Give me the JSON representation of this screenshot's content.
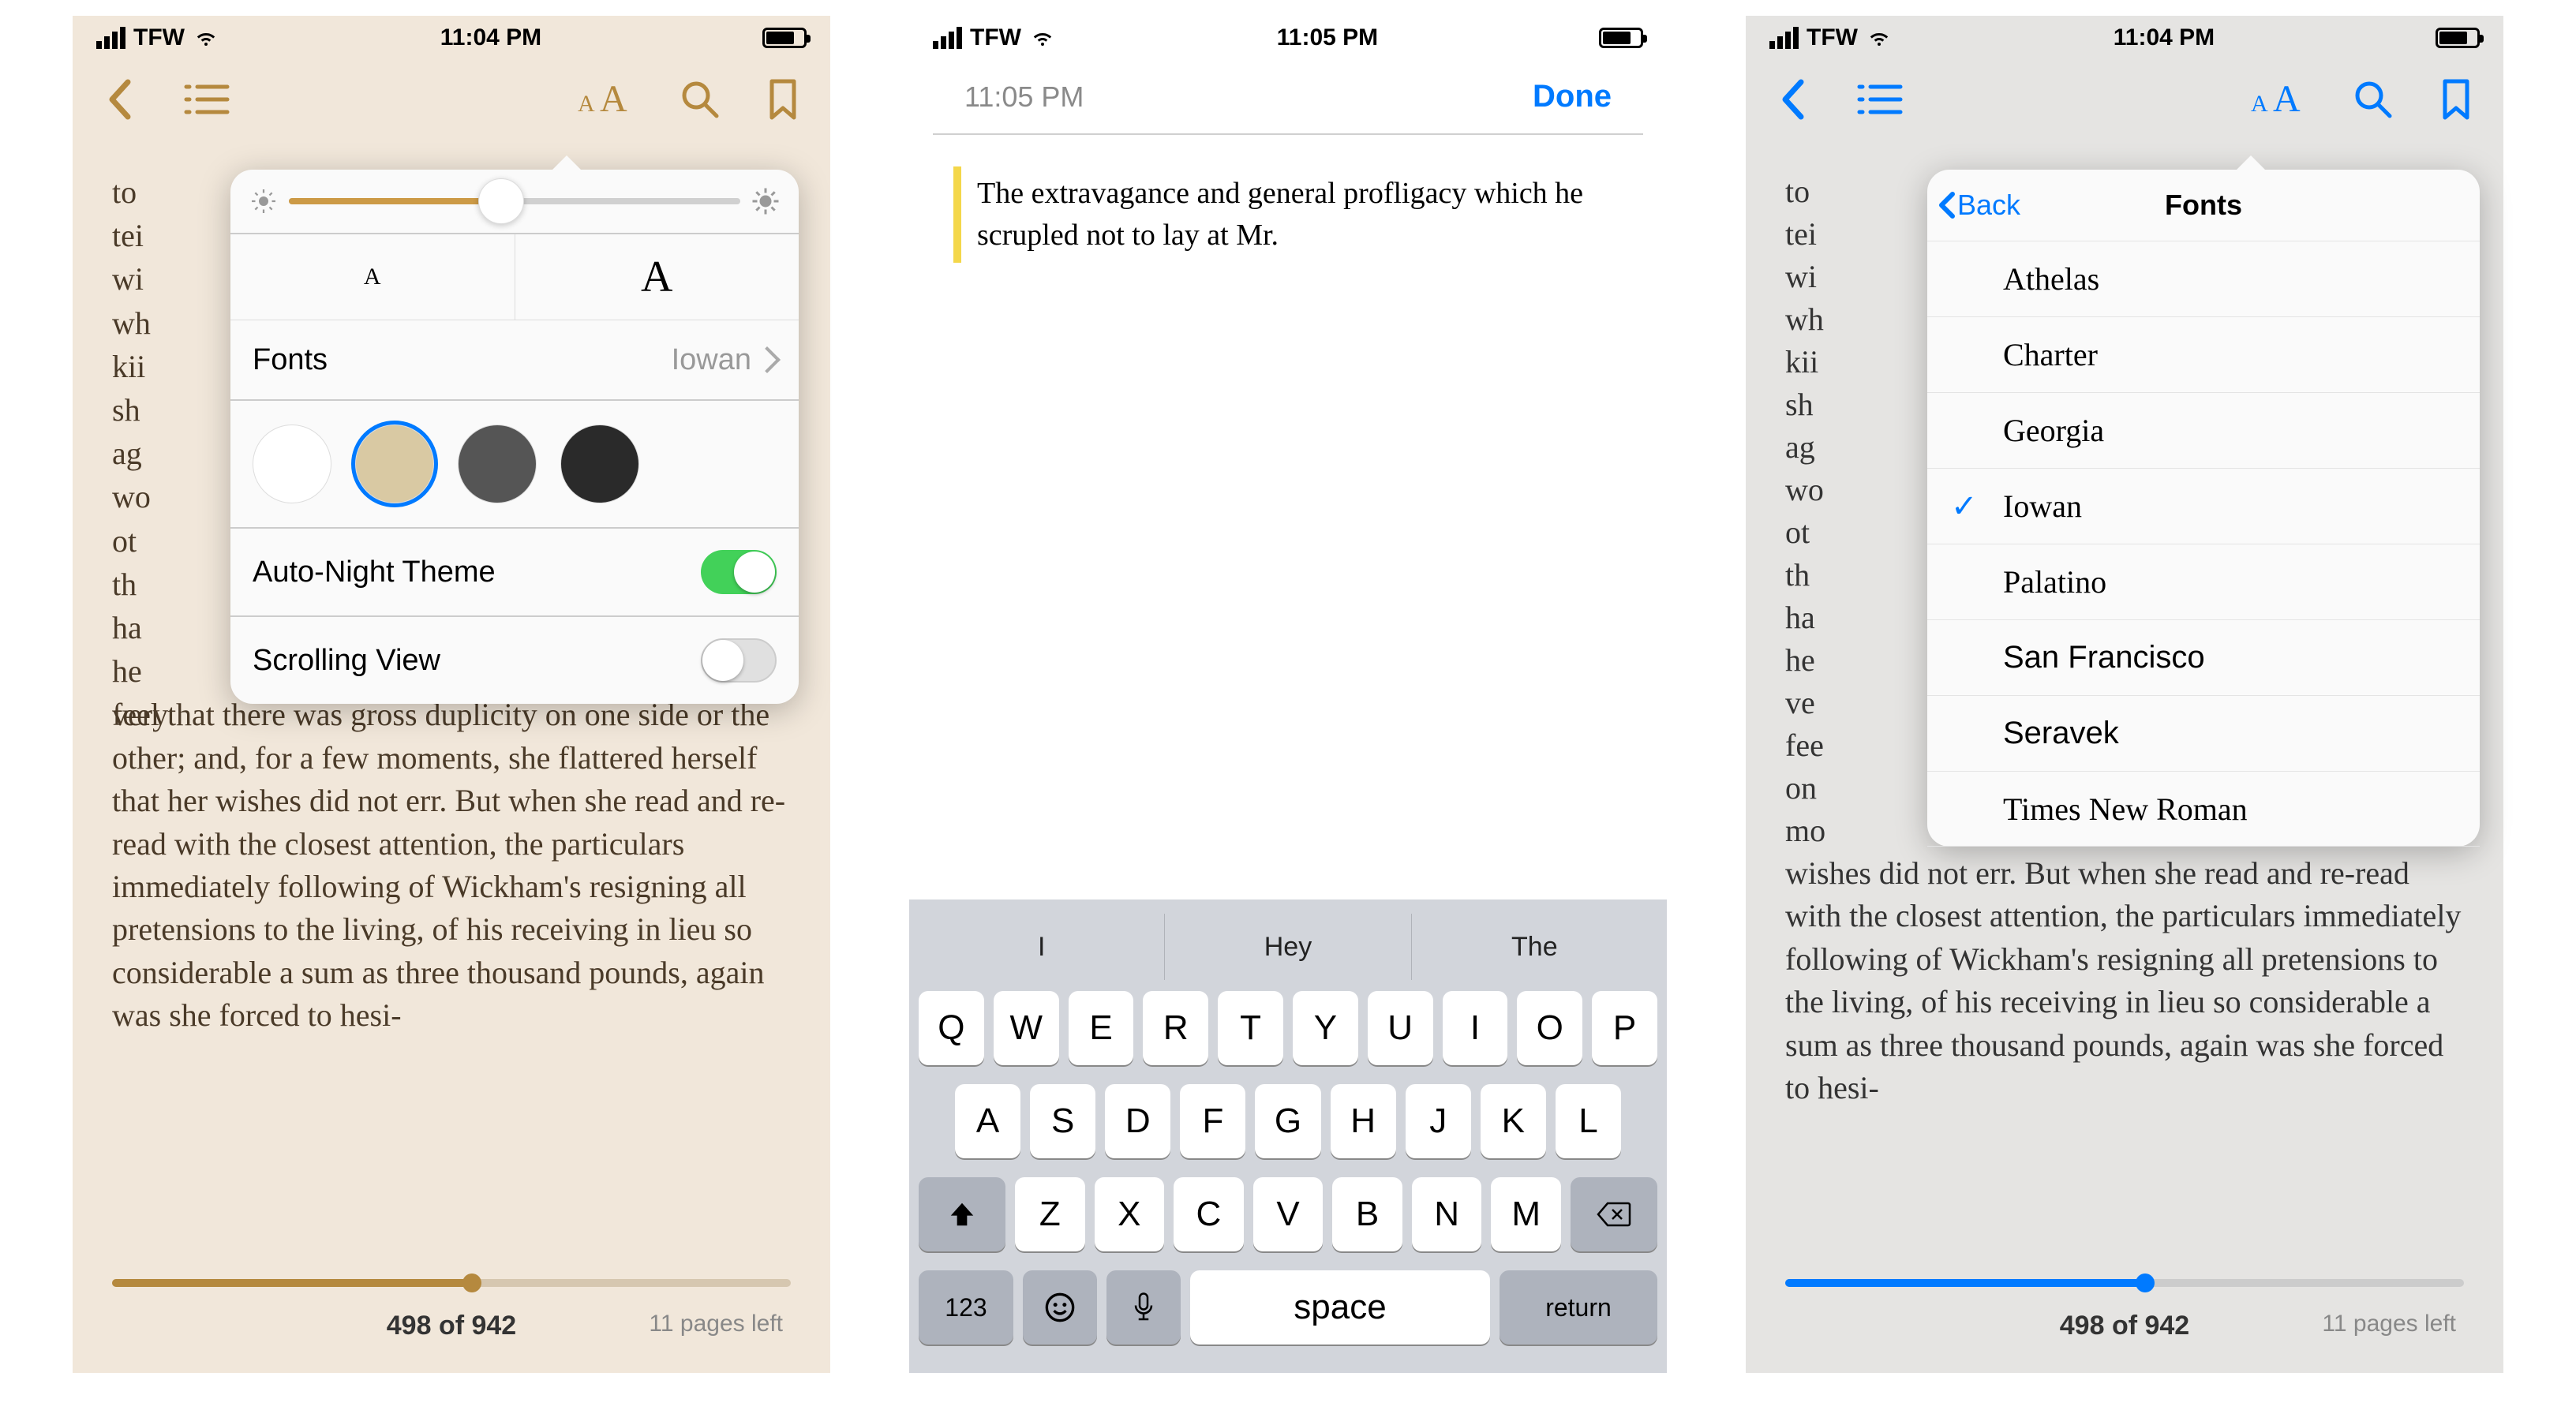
{
  "status": {
    "carrier": "TFW",
    "time_p1": "11:04 PM",
    "time_p2": "11:05 PM",
    "time_p3": "11:04 PM"
  },
  "p1": {
    "accent": "#b5893e",
    "fragments": [
      "to",
      "tei",
      "wi",
      "wh",
      "kii",
      "sh",
      "ag",
      "wo",
      "ot",
      "th",
      "ha",
      "he"
    ],
    "body": "very ready, to disregard that to feel that there was gross duplicity on one side or the other; and, for a few moments, she flattered herself that her wishes did not err. But when she read and re-read with the closest attention, the particulars immediately following of Wickham's resigning all pretensions to the living, of his receiving in lieu so considerable a sum as three thousand pounds, again was she forced to hesi-",
    "page_of": "498 of 942",
    "pages_left": "11 pages left",
    "popover": {
      "fonts_label": "Fonts",
      "fonts_value": "Iowan",
      "size_small": "A",
      "size_big": "A",
      "swatches": [
        "#ffffff",
        "#d9c9a3",
        "#555555",
        "#2a2a2a"
      ],
      "selected_swatch": 1,
      "auto_night": "Auto-Night Theme",
      "auto_night_on": true,
      "scrolling": "Scrolling View",
      "scrolling_on": false
    }
  },
  "p2": {
    "header_time": "11:05 PM",
    "done": "Done",
    "note": "The extravagance and general profligacy which he scrupled not to lay at Mr.",
    "suggestions": [
      "I",
      "Hey",
      "The"
    ],
    "row1": [
      "Q",
      "W",
      "E",
      "R",
      "T",
      "Y",
      "U",
      "I",
      "O",
      "P"
    ],
    "row2": [
      "A",
      "S",
      "D",
      "F",
      "G",
      "H",
      "J",
      "K",
      "L"
    ],
    "row3": [
      "Z",
      "X",
      "C",
      "V",
      "B",
      "N",
      "M"
    ],
    "numkey": "123",
    "space": "space",
    "return": "return"
  },
  "p3": {
    "accent": "#007aff",
    "fragments": [
      "to",
      "tei",
      "wi",
      "wh",
      "kii",
      "sh",
      "ag",
      "wo",
      "ot",
      "th",
      "ha",
      "he",
      "ve",
      "fee",
      "on",
      "mo"
    ],
    "body": "wishes did not err. But when she read and re-read with the closest attention, the particulars immediately following of Wickham's resigning all pretensions to the living, of his receiving in lieu so considerable a sum as three thousand pounds, again was she forced to hesi-",
    "page_of": "498 of 942",
    "pages_left": "11 pages left",
    "popover": {
      "back": "Back",
      "title": "Fonts",
      "fonts": [
        "Athelas",
        "Charter",
        "Georgia",
        "Iowan",
        "Palatino",
        "San Francisco",
        "Seravek",
        "Times New Roman"
      ],
      "selected": "Iowan"
    }
  }
}
